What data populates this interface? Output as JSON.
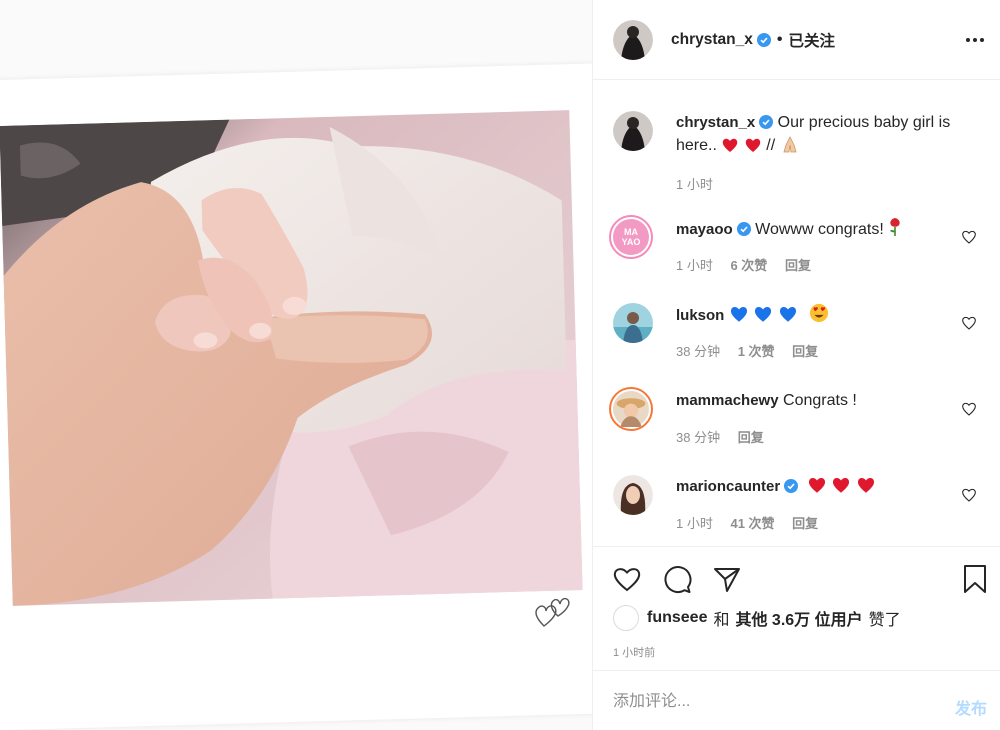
{
  "post": {
    "author": "chrystan_x",
    "follow_separator": "•",
    "follow_status": "已关注",
    "caption_text": "Our precious baby girl is here..",
    "caption_tail": "//",
    "caption_time": "1 小时"
  },
  "comments": [
    {
      "username": "mayaoo",
      "verified": true,
      "text": "Wowww congrats!",
      "time": "1 小时",
      "likes": "6 次赞",
      "reply": "回复"
    },
    {
      "username": "lukson",
      "verified": false,
      "text": "",
      "time": "38 分钟",
      "likes": "1 次赞",
      "reply": "回复"
    },
    {
      "username": "mammachewy",
      "verified": false,
      "text": "Congrats !",
      "time": "38 分钟",
      "likes": "",
      "reply": "回复"
    },
    {
      "username": "marioncaunter",
      "verified": true,
      "text": "",
      "time": "1 小时",
      "likes": "41 次赞",
      "reply": "回复"
    }
  ],
  "avatar_text": {
    "mayaoo_line1": "MA",
    "mayaoo_line2": "YAO"
  },
  "likes": {
    "user": "funseee",
    "and": "和",
    "others_bold": "其他 3.6万 位用户",
    "suffix": "赞了"
  },
  "post_time": "1 小时前",
  "add_comment": {
    "placeholder": "添加评论...",
    "post_label": "发布"
  },
  "icons": {
    "verified": "verified-badge-icon",
    "more": "more-options-icon",
    "like": "heart-icon",
    "comment": "comment-icon",
    "share": "paper-plane-icon",
    "save": "bookmark-icon"
  },
  "colors": {
    "verified_blue": "#3897f0",
    "post_button_disabled": "#b3dbff",
    "meta_gray": "#8e8e8e",
    "heart_red": "#e0182d",
    "heart_blue": "#1a73e8"
  }
}
